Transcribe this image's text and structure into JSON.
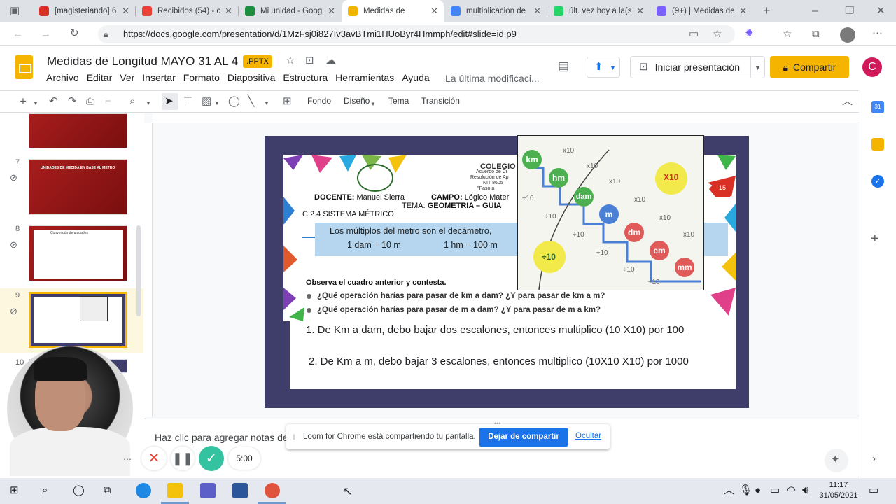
{
  "browser": {
    "tabs": [
      {
        "title": "[magisteriando] 6",
        "color": "#d93025"
      },
      {
        "title": "Recibidos (54) - c",
        "color": "#ea4335"
      },
      {
        "title": "Mi unidad - Goog",
        "color": "#1e8e3e"
      },
      {
        "title": "Medidas de",
        "color": "#f4b400"
      },
      {
        "title": "multiplicacion de",
        "color": "#4285f4"
      },
      {
        "title": "últ. vez hoy a la(s",
        "color": "#25d366"
      },
      {
        "title": "(9+) | Medidas de",
        "color": "#7b61ff"
      }
    ],
    "url": "https://docs.google.com/presentation/d/1MzFsj0i827Iv3avBTmi1HUoByr4Hmmph/edit#slide=id.p9"
  },
  "doc": {
    "title": "Medidas de Longitud MAYO 31 AL 4",
    "badge": ".PPTX",
    "menus": [
      "Archivo",
      "Editar",
      "Ver",
      "Insertar",
      "Formato",
      "Diapositiva",
      "Estructura",
      "Herramientas",
      "Ayuda"
    ],
    "last_modified": "La última modificaci...",
    "present_label": "Iniciar presentación",
    "share_label": "Compartir",
    "avatar_letter": "C"
  },
  "toolbar": {
    "fondo": "Fondo",
    "diseno": "Diseño",
    "tema": "Tema",
    "transicion": "Transición"
  },
  "thumbnails": {
    "numbers": [
      "7",
      "8",
      "9",
      "10"
    ],
    "t7_title": "UNIDADES DE MEDIDA EN BASE AL METRO",
    "t8_title": "Conversión de unidades"
  },
  "slide": {
    "docente_label": "DOCENTE:",
    "docente_name": "Manuel Sierra",
    "campo_label": "CAMPO:",
    "campo_value": "Lógico Mater",
    "tema_label": "TEMA:",
    "tema_value": "GEOMETRIA – GUIA",
    "colegio": "COLEGIO",
    "acuerdo": "Acuerdo de Cr",
    "resolucion": "Resolución de Ap",
    "nit": "NIT 8605",
    "paso": "\"Paso a",
    "section": "C.2.4 SISTEMA MÉTRICO",
    "box_line1": "Los múltiplos del metro son el decámetro,",
    "box_line2a": "1 dam = 10 m",
    "box_line2b": "1 hm = 100 m",
    "observa": "Observa el cuadro anterior y contesta.",
    "q1": "¿Qué operación harías para pasar de km a dam? ¿Y para pasar de km a m?",
    "q2": "¿Qué operación harías para pasar de m a dam? ¿Y para pasar de m a km?",
    "a1": "1.    De Km a dam, debo bajar dos escalones, entonces multiplico (10 X10) por 100",
    "a2": "2. De Km a m, debo bajar 3 escalones, entonces multiplico (10X10 X10) por 1000",
    "page_tag": "15"
  },
  "stairs": {
    "units": [
      "km",
      "hm",
      "dam",
      "m",
      "dm",
      "cm",
      "mm"
    ],
    "colors": [
      "#4caf50",
      "#4caf50",
      "#4caf50",
      "#4a7fd6",
      "#e05a5a",
      "#e05a5a",
      "#e05a5a"
    ],
    "times": "x10",
    "div": "÷10",
    "big_times": "X10",
    "big_div": "÷10"
  },
  "notes_placeholder": "Haz clic para agregar notas de",
  "loom": {
    "message": "Loom for Chrome está compartiendo tu pantalla.",
    "stop_label": "Dejar de compartir",
    "hide_label": "Ocultar"
  },
  "recorder": {
    "timer": "5:00"
  },
  "taskbar": {
    "time": "11:17",
    "date": "31/05/2021"
  }
}
